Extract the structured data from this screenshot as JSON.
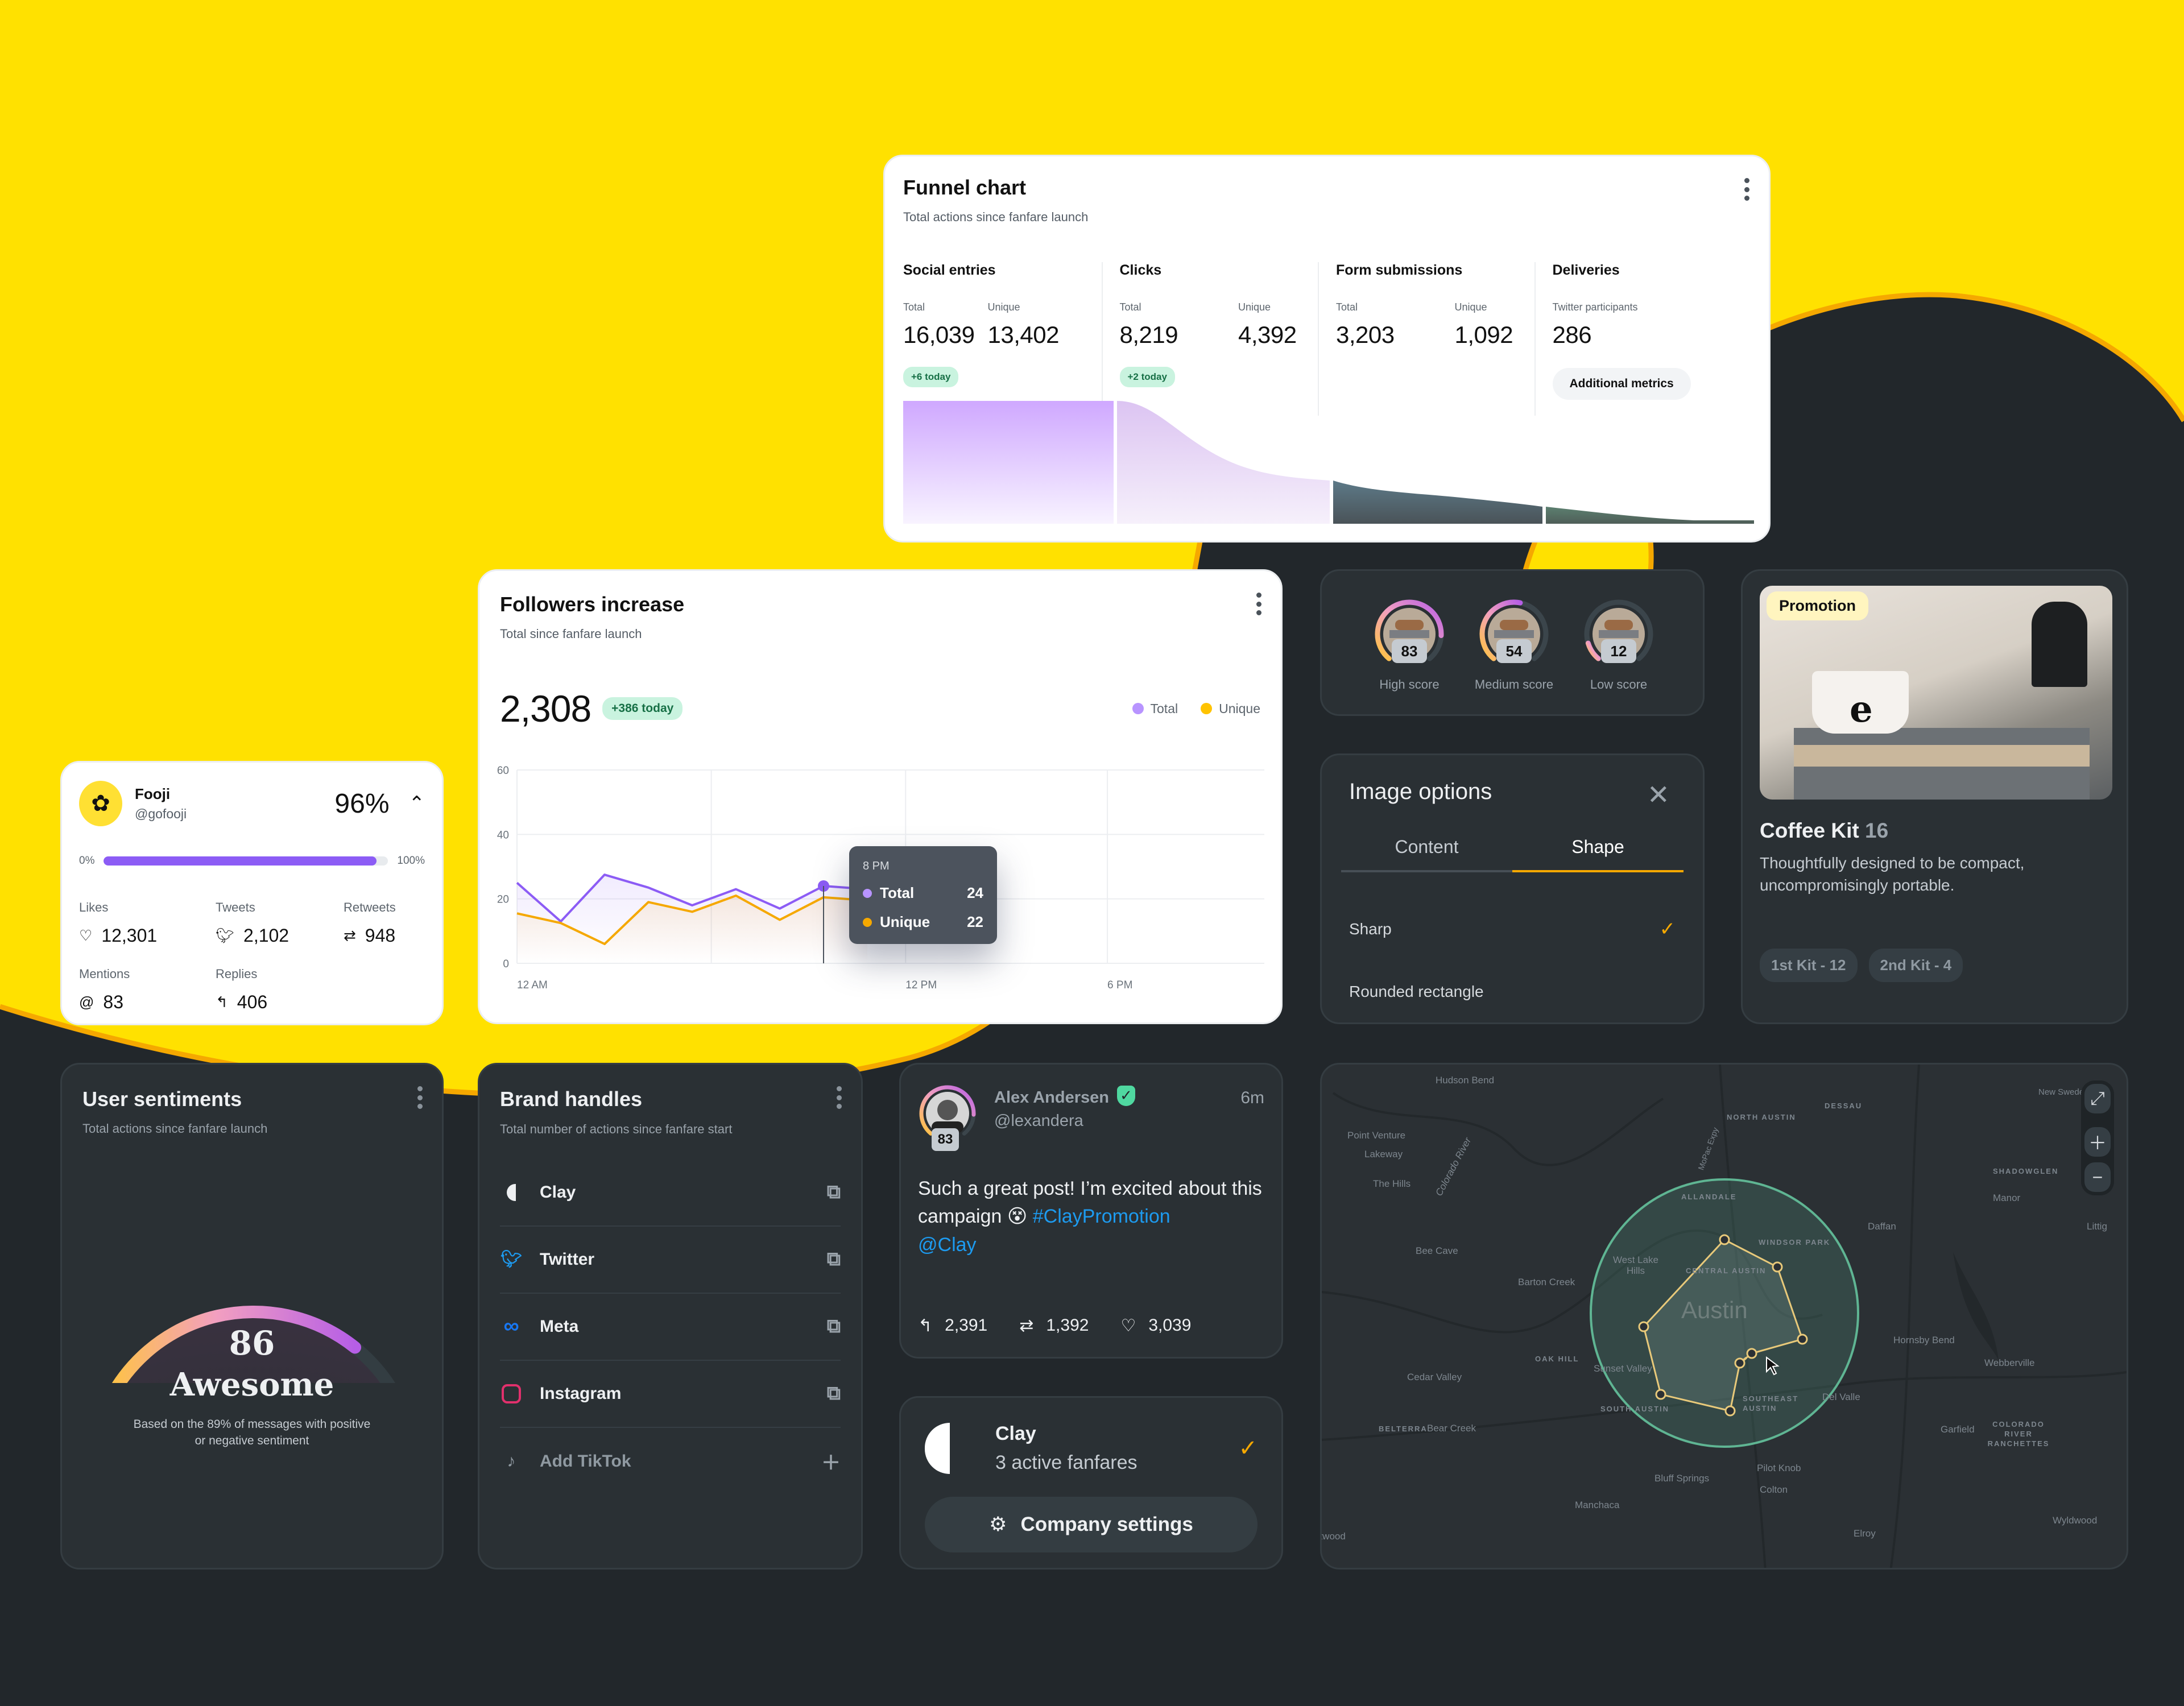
{
  "colors": {
    "yellow": "#ffe100",
    "dark": "#22272b",
    "accent_orange": "#f5a800",
    "purple": "#8c5cf5",
    "green_badge": "#c9f3df",
    "twitter_blue": "#1d9bf0"
  },
  "funnel": {
    "title": "Funnel chart",
    "subtitle": "Total actions since fanfare launch",
    "columns": [
      {
        "name": "Social entries",
        "metrics": [
          {
            "label": "Total",
            "value": "16,039"
          },
          {
            "label": "Unique",
            "value": "13,402"
          }
        ],
        "badge": "+6 today"
      },
      {
        "name": "Clicks",
        "metrics": [
          {
            "label": "Total",
            "value": "8,219"
          },
          {
            "label": "Unique",
            "value": "4,392"
          }
        ],
        "badge": "+2 today"
      },
      {
        "name": "Form submissions",
        "metrics": [
          {
            "label": "Total",
            "value": "3,203"
          },
          {
            "label": "Unique",
            "value": "1,092"
          }
        ]
      },
      {
        "name": "Deliveries",
        "metrics": [
          {
            "label": "Twitter participants",
            "value": "286"
          }
        ],
        "button": "Additional metrics"
      }
    ]
  },
  "followers": {
    "title": "Followers increase",
    "subtitle": "Total since fanfare launch",
    "total": "2,308",
    "badge": "+386 today",
    "tooltip": {
      "time": "8 PM",
      "rows": [
        {
          "label": "Total",
          "value": "24"
        },
        {
          "label": "Unique",
          "value": "22"
        }
      ]
    }
  },
  "chart_data": {
    "type": "line",
    "title": "Followers increase",
    "x_ticks": [
      "12 AM",
      "12 PM",
      "6 PM"
    ],
    "y_ticks": [
      "0",
      "20",
      "40",
      "60"
    ],
    "ylim": [
      0,
      60
    ],
    "legend": [
      "Total",
      "Unique"
    ],
    "legend_position": "top-right",
    "series": [
      {
        "name": "Total",
        "color": "#8c5cf5",
        "values": [
          25,
          13,
          27.5,
          23.5,
          18,
          23,
          17,
          24,
          23
        ]
      },
      {
        "name": "Unique",
        "color": "#f5a800",
        "values": [
          15.5,
          12.5,
          6,
          19,
          16,
          21,
          13.5,
          20.5,
          19.5
        ]
      }
    ],
    "highlight_index": 7
  },
  "fooji": {
    "name": "Fooji",
    "handle": "@gofooji",
    "percent": "96%",
    "progress_fraction": 0.96,
    "min_label": "0%",
    "max_label": "100%",
    "stats": [
      {
        "label": "Likes",
        "value": "12,301",
        "icon": "heart-icon"
      },
      {
        "label": "Tweets",
        "value": "2,102",
        "icon": "twitter-icon"
      },
      {
        "label": "Retweets",
        "value": "948",
        "icon": "retweet-icon"
      },
      {
        "label": "Mentions",
        "value": "83",
        "icon": "at-icon"
      },
      {
        "label": "Replies",
        "value": "406",
        "icon": "reply-icon"
      }
    ]
  },
  "scores": [
    {
      "label": "High score",
      "value": "83",
      "fraction": 0.83
    },
    {
      "label": "Medium score",
      "value": "54",
      "fraction": 0.54
    },
    {
      "label": "Low score",
      "value": "12",
      "fraction": 0.12
    }
  ],
  "image_options": {
    "title": "Image options",
    "tabs": [
      "Content",
      "Shape"
    ],
    "active_tab": "Shape",
    "options": [
      {
        "label": "Sharp",
        "selected": true
      },
      {
        "label": "Rounded rectangle",
        "selected": false
      }
    ]
  },
  "promotion": {
    "tag": "Promotion",
    "title": "Coffee Kit",
    "count": "16",
    "description": "Thoughtfully designed to be compact, uncompromisingly portable.",
    "chips": [
      "1st Kit - 12",
      "2nd Kit - 4"
    ]
  },
  "sentiments": {
    "title": "User sentiments",
    "subtitle": "Total actions since fanfare launch",
    "score": "86",
    "score_fraction": 0.86,
    "word": "Awesome",
    "note": "Based on the 89% of messages with positive or negative sentiment"
  },
  "brands": {
    "title": "Brand handles",
    "subtitle": "Total number of actions since fanfare start",
    "items": [
      {
        "label": "Clay",
        "icon": "clay-icon",
        "action": "external-link-icon"
      },
      {
        "label": "Twitter",
        "icon": "twitter-icon",
        "action": "external-link-icon"
      },
      {
        "label": "Meta",
        "icon": "meta-icon",
        "action": "external-link-icon"
      },
      {
        "label": "Instagram",
        "icon": "instagram-icon",
        "action": "external-link-icon"
      },
      {
        "label": "Add TikTok",
        "icon": "tiktok-icon",
        "action": "plus-icon"
      }
    ]
  },
  "tweet": {
    "name": "Alex Andersen",
    "handle": "@lexandera",
    "time": "6m",
    "score": "83",
    "score_fraction": 0.83,
    "text": "Such a great post! I’m excited about this campaign 😵",
    "hashtag": "#ClayPromotion",
    "mention": "@Clay",
    "replies": "2,391",
    "retweets": "1,392",
    "likes": "3,039"
  },
  "clay": {
    "name": "Clay",
    "status": "3 active fanfares",
    "button": "Company settings"
  },
  "map": {
    "city": "Austin",
    "labels": [
      {
        "t": "Hudson Bend"
      },
      {
        "t": "Point Venture"
      },
      {
        "t": "Lakeway"
      },
      {
        "t": "The Hills"
      },
      {
        "t": "Colorado River"
      },
      {
        "t": "Bee Cave"
      },
      {
        "t": "Barton Creek"
      },
      {
        "t": "West Lake Hills"
      },
      {
        "t": "NORTH AUSTIN"
      },
      {
        "t": "DESSAU"
      },
      {
        "t": "ALLANDALE"
      },
      {
        "t": "WINDSOR PARK"
      },
      {
        "t": "CENTRAL AUSTIN"
      },
      {
        "t": "MoPac Expy"
      },
      {
        "t": "New Sweden"
      },
      {
        "t": "SHADOWGLEN"
      },
      {
        "t": "Manor"
      },
      {
        "t": "Daffan"
      },
      {
        "t": "Littig"
      },
      {
        "t": "Hornsby Bend"
      },
      {
        "t": "Webberville"
      },
      {
        "t": "OAK HILL"
      },
      {
        "t": "Sunset Valley"
      },
      {
        "t": "Cedar Valley"
      },
      {
        "t": "SOUTH AUSTIN"
      },
      {
        "t": "SOUTHEAST AUSTIN"
      },
      {
        "t": "Del Valle"
      },
      {
        "t": "BELTERRA"
      },
      {
        "t": "Bear Creek"
      },
      {
        "t": "Garfield"
      },
      {
        "t": "COLORADO RIVER RANCHETTES"
      },
      {
        "t": "Pilot Knob"
      },
      {
        "t": "Bluff Springs"
      },
      {
        "t": "Colton"
      },
      {
        "t": "Manchaca"
      },
      {
        "t": "Elroy"
      },
      {
        "t": "Wyldwood"
      },
      {
        "t": "Driftwood"
      }
    ],
    "controls": [
      "expand",
      "zoom-in",
      "zoom-out"
    ]
  }
}
